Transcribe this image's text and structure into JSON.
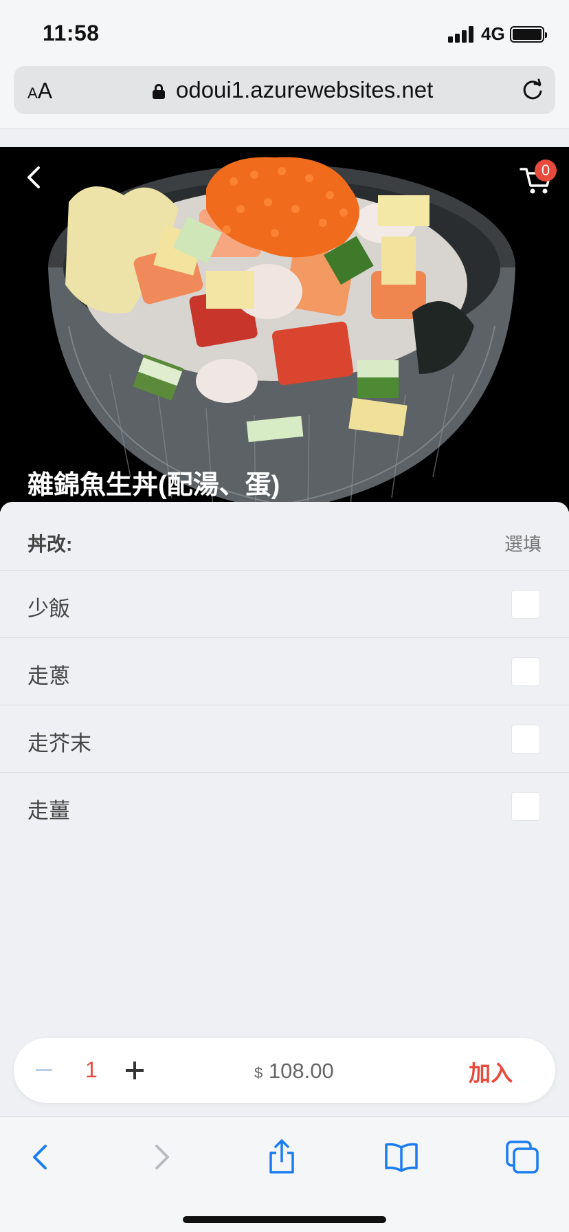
{
  "status_bar": {
    "time": "11:58",
    "network": "4G"
  },
  "browser": {
    "text_size_label_small": "A",
    "text_size_label_large": "A",
    "url": "odoui1.azurewebsites.net"
  },
  "product": {
    "title": "雜錦魚生丼(配湯、蛋)",
    "cart_count": "0"
  },
  "options": {
    "group_label": "丼改:",
    "group_tag": "選填",
    "items": [
      {
        "label": "少飯",
        "checked": false
      },
      {
        "label": "走蔥",
        "checked": false
      },
      {
        "label": "走芥末",
        "checked": false
      },
      {
        "label": "走薑",
        "checked": false
      }
    ]
  },
  "order": {
    "quantity": "1",
    "currency": "$",
    "price": "108.00",
    "add_label": "加入"
  },
  "colors": {
    "accent": "#e84a3d",
    "ios_blue": "#1a7cf0",
    "background": "#eef0f3"
  },
  "icons": [
    "back-icon",
    "cart-icon",
    "lock-icon",
    "reload-icon",
    "minus-icon",
    "plus-icon",
    "share-icon",
    "bookmarks-icon",
    "tabs-icon",
    "forward-icon"
  ]
}
